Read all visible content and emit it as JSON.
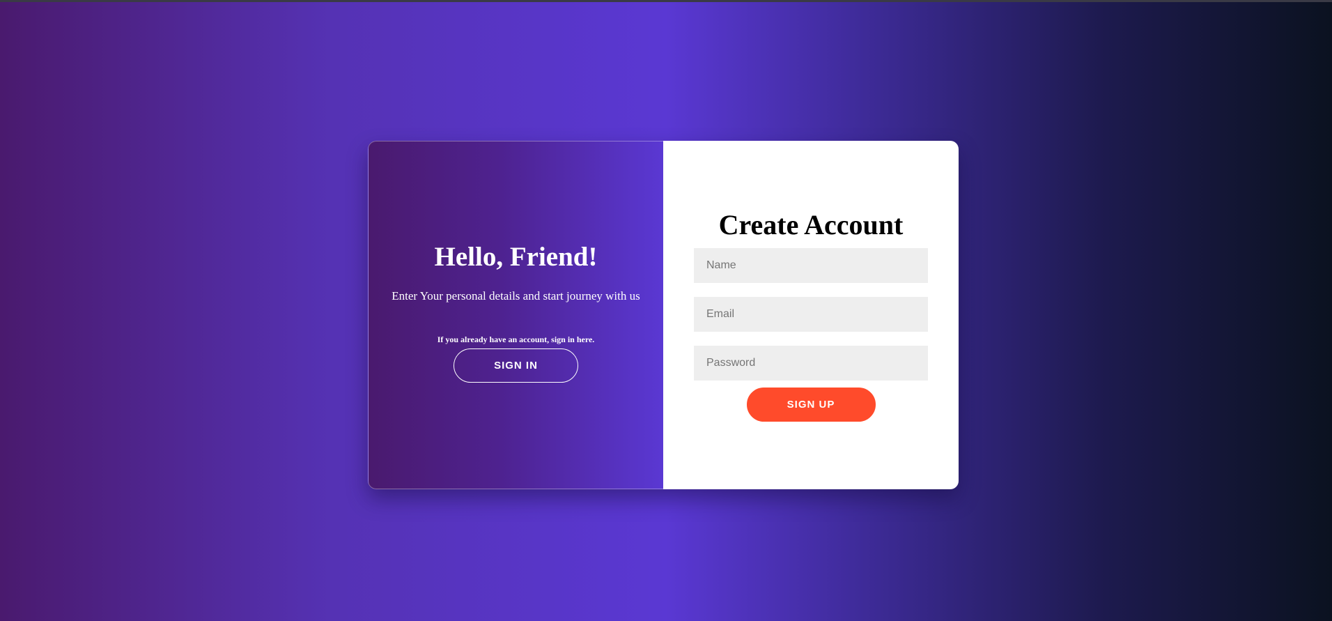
{
  "overlay": {
    "title": "Hello, Friend!",
    "text": "Enter Your personal details and start journey with us",
    "hint": "If you already have an account, sign in here.",
    "signin_label": "SIGN IN"
  },
  "form": {
    "title": "Create Account",
    "name_placeholder": "Name",
    "email_placeholder": "Email",
    "password_placeholder": "Password",
    "signup_label": "SIGN UP"
  },
  "colors": {
    "accent": "#ff4b2b",
    "gradient_start": "#4a1a6e",
    "gradient_mid": "#5a38d3",
    "gradient_end": "#0b1220",
    "input_background": "#eeeeee"
  }
}
